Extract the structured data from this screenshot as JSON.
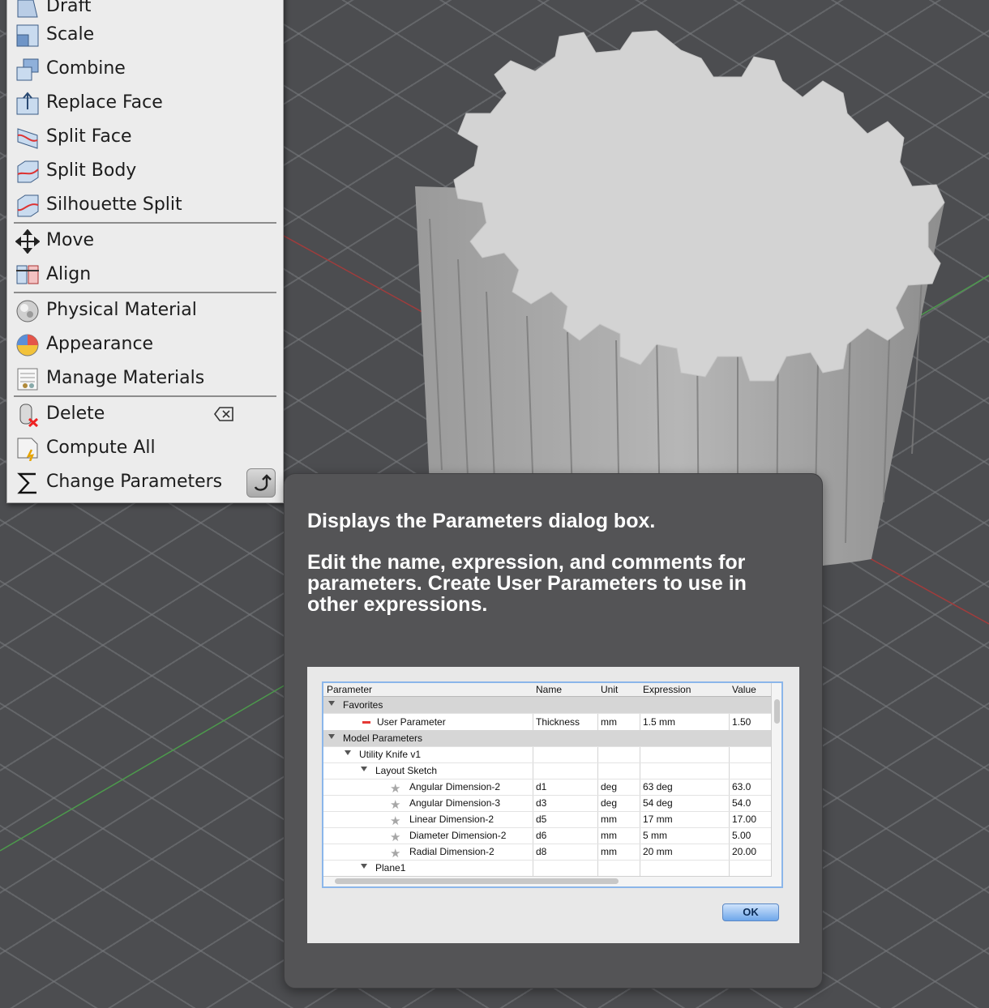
{
  "menu": {
    "items": [
      {
        "label": "Draft",
        "icon": "draft-icon"
      },
      {
        "label": "Scale",
        "icon": "scale-icon"
      },
      {
        "label": "Combine",
        "icon": "combine-icon"
      },
      {
        "label": "Replace Face",
        "icon": "replace-face-icon"
      },
      {
        "label": "Split Face",
        "icon": "split-face-icon"
      },
      {
        "label": "Split Body",
        "icon": "split-body-icon"
      },
      {
        "label": "Silhouette Split",
        "icon": "silhouette-split-icon"
      },
      {
        "label": "Move",
        "icon": "move-icon"
      },
      {
        "label": "Align",
        "icon": "align-icon"
      },
      {
        "label": "Physical Material",
        "icon": "physical-material-icon"
      },
      {
        "label": "Appearance",
        "icon": "appearance-icon"
      },
      {
        "label": "Manage Materials",
        "icon": "manage-materials-icon"
      },
      {
        "label": "Delete",
        "icon": "delete-icon"
      },
      {
        "label": "Compute All",
        "icon": "compute-all-icon"
      },
      {
        "label": "Change Parameters",
        "icon": "sigma-icon"
      }
    ]
  },
  "tooltip": {
    "title": "Displays the Parameters dialog box.",
    "body": "Edit the name, expression, and comments for parameters. Create User Parameters to use in other expressions.",
    "dialog": {
      "headers": [
        "Parameter",
        "Name",
        "Unit",
        "Expression",
        "Value"
      ],
      "rows": [
        {
          "parameter": "Favorites",
          "name": "",
          "unit": "",
          "expression": "",
          "value": ""
        },
        {
          "parameter": "User Parameter",
          "name": "Thickness",
          "unit": "mm",
          "expression": "1.5 mm",
          "value": "1.50"
        },
        {
          "parameter": "Model Parameters",
          "name": "",
          "unit": "",
          "expression": "",
          "value": ""
        },
        {
          "parameter": "Utility Knife v1",
          "name": "",
          "unit": "",
          "expression": "",
          "value": ""
        },
        {
          "parameter": "Layout Sketch",
          "name": "",
          "unit": "",
          "expression": "",
          "value": ""
        },
        {
          "parameter": "Angular Dimension-2",
          "name": "d1",
          "unit": "deg",
          "expression": "63 deg",
          "value": "63.0"
        },
        {
          "parameter": "Angular Dimension-3",
          "name": "d3",
          "unit": "deg",
          "expression": "54 deg",
          "value": "54.0"
        },
        {
          "parameter": "Linear Dimension-2",
          "name": "d5",
          "unit": "mm",
          "expression": "17 mm",
          "value": "17.00"
        },
        {
          "parameter": "Diameter Dimension-2",
          "name": "d6",
          "unit": "mm",
          "expression": "5 mm",
          "value": "5.00"
        },
        {
          "parameter": "Radial Dimension-2",
          "name": "d8",
          "unit": "mm",
          "expression": "20 mm",
          "value": "20.00"
        },
        {
          "parameter": "Plane1",
          "name": "",
          "unit": "",
          "expression": "",
          "value": ""
        }
      ],
      "ok_label": "OK"
    }
  }
}
